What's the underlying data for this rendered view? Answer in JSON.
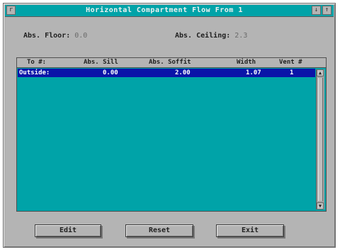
{
  "window": {
    "title": "Horizontal Compartment Flow From 1",
    "sys_left": "r",
    "sys_right_1": "↓",
    "sys_right_2": "↑"
  },
  "fields": {
    "floor_label": "Abs. Floor:",
    "floor_value": "0.0",
    "ceiling_label": "Abs. Ceiling:",
    "ceiling_value": "2.3"
  },
  "table": {
    "headers": [
      "To #:",
      "Abs. Sill",
      "Abs. Soffit",
      "Width",
      "Vent #"
    ],
    "rows": [
      [
        "Outside:",
        "0.00",
        "2.00",
        "1.07",
        "1"
      ]
    ]
  },
  "buttons": {
    "edit": "Edit",
    "reset": "Reset",
    "exit": "Exit"
  },
  "icons": {
    "scroll_up": "triangle-up",
    "scroll_down": "triangle-down"
  }
}
